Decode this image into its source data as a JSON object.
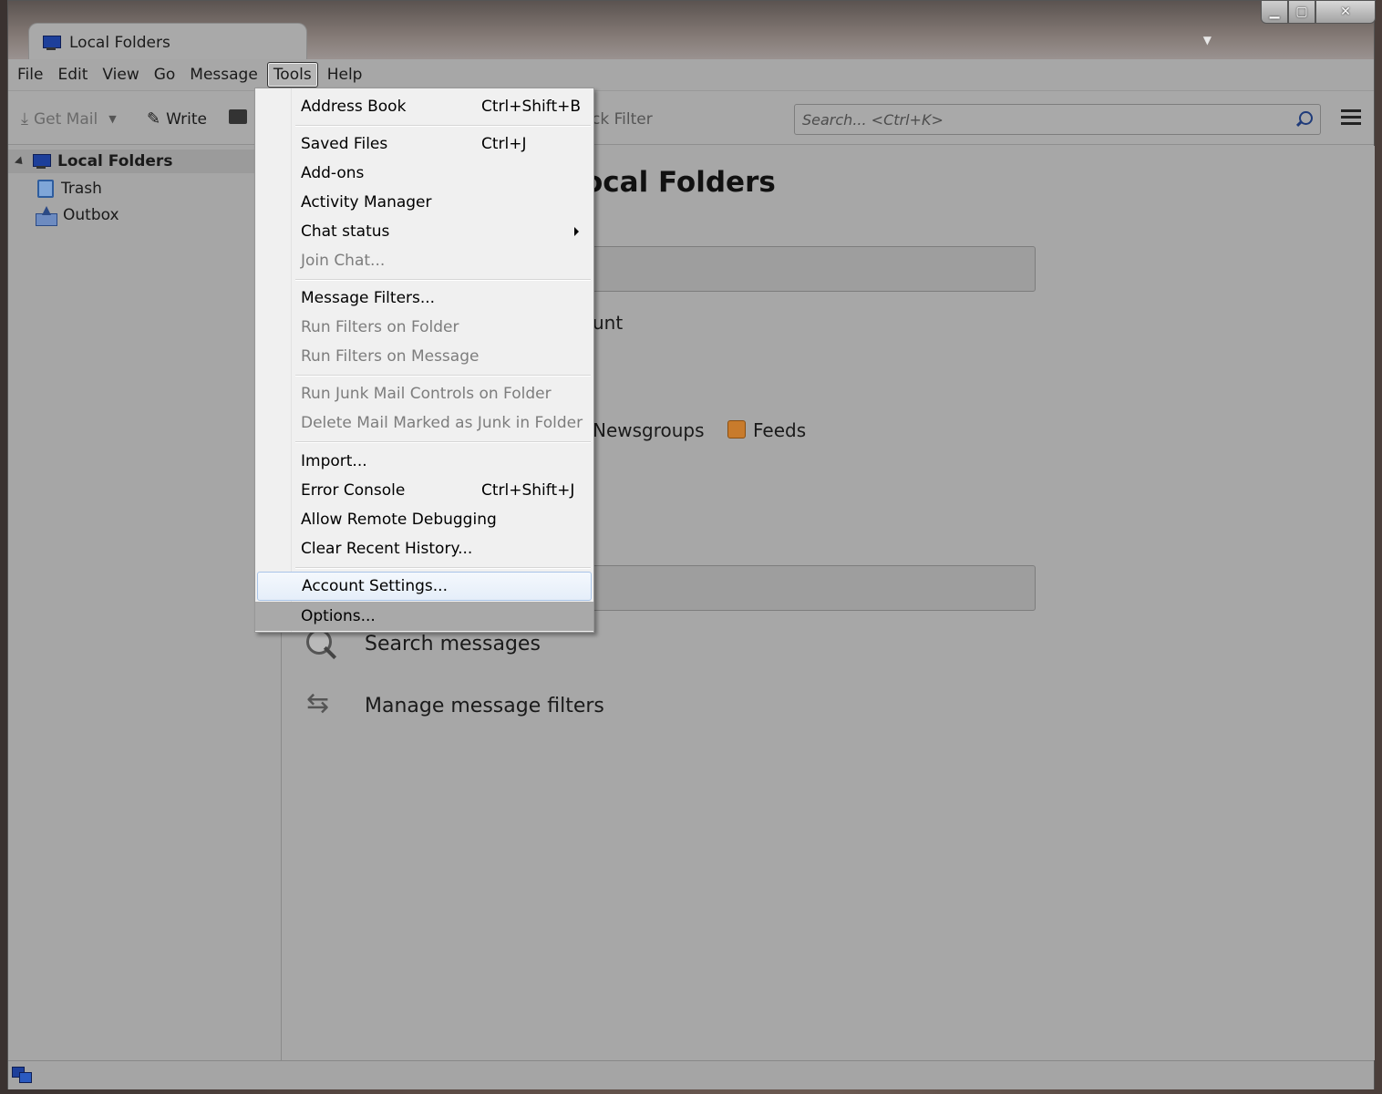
{
  "window": {
    "tab_title": "Local Folders",
    "controls": {
      "minimize": "▁",
      "maximize": "▢",
      "close": "✕"
    },
    "tab_menu_arrow": "▼"
  },
  "menubar": {
    "items": [
      "File",
      "Edit",
      "View",
      "Go",
      "Message",
      "Tools",
      "Help"
    ],
    "active": "Tools"
  },
  "toolbar": {
    "get_mail": "Get Mail",
    "write": "Write",
    "quick_filter_fragment": "ck Filter",
    "search_placeholder": "Search... <Ctrl+K>"
  },
  "folder_pane": {
    "account": "Local Folders",
    "folders": [
      "Trash",
      "Outbox"
    ]
  },
  "main": {
    "title_fragment": "ocal Folders",
    "account_fragment": "unt",
    "newsgroups_fragment": "Newsgroups",
    "feeds": "Feeds",
    "search_messages": "Search messages",
    "manage_filters": "Manage message filters"
  },
  "tools_menu": {
    "items": [
      {
        "label": "Address Book",
        "shortcut": "Ctrl+Shift+B",
        "enabled": true
      },
      {
        "label": "Saved Files",
        "shortcut": "Ctrl+J",
        "enabled": true
      },
      {
        "label": "Add-ons",
        "shortcut": "",
        "enabled": true
      },
      {
        "label": "Activity Manager",
        "shortcut": "",
        "enabled": true
      },
      {
        "label": "Chat status",
        "shortcut": "",
        "enabled": true,
        "submenu": true
      },
      {
        "label": "Join Chat...",
        "shortcut": "",
        "enabled": false
      },
      {
        "label": "Message Filters...",
        "shortcut": "",
        "enabled": true
      },
      {
        "label": "Run Filters on Folder",
        "shortcut": "",
        "enabled": false
      },
      {
        "label": "Run Filters on Message",
        "shortcut": "",
        "enabled": false
      },
      {
        "label": "Run Junk Mail Controls on Folder",
        "shortcut": "",
        "enabled": false
      },
      {
        "label": "Delete Mail Marked as Junk in Folder",
        "shortcut": "",
        "enabled": false
      },
      {
        "label": "Import...",
        "shortcut": "",
        "enabled": true
      },
      {
        "label": "Error Console",
        "shortcut": "Ctrl+Shift+J",
        "enabled": true
      },
      {
        "label": "Allow Remote Debugging",
        "shortcut": "",
        "enabled": true
      },
      {
        "label": "Clear Recent History...",
        "shortcut": "",
        "enabled": true
      },
      {
        "label": "Account Settings...",
        "shortcut": "",
        "enabled": true,
        "highlighted": true
      },
      {
        "label": "Options...",
        "shortcut": "",
        "enabled": true
      }
    ]
  },
  "colors": {
    "menu_bg": "#f0f0f0",
    "disabled_text": "#7d7d7d",
    "highlight_border": "#a9c4e8",
    "window_bg": "#a7a7a7"
  }
}
